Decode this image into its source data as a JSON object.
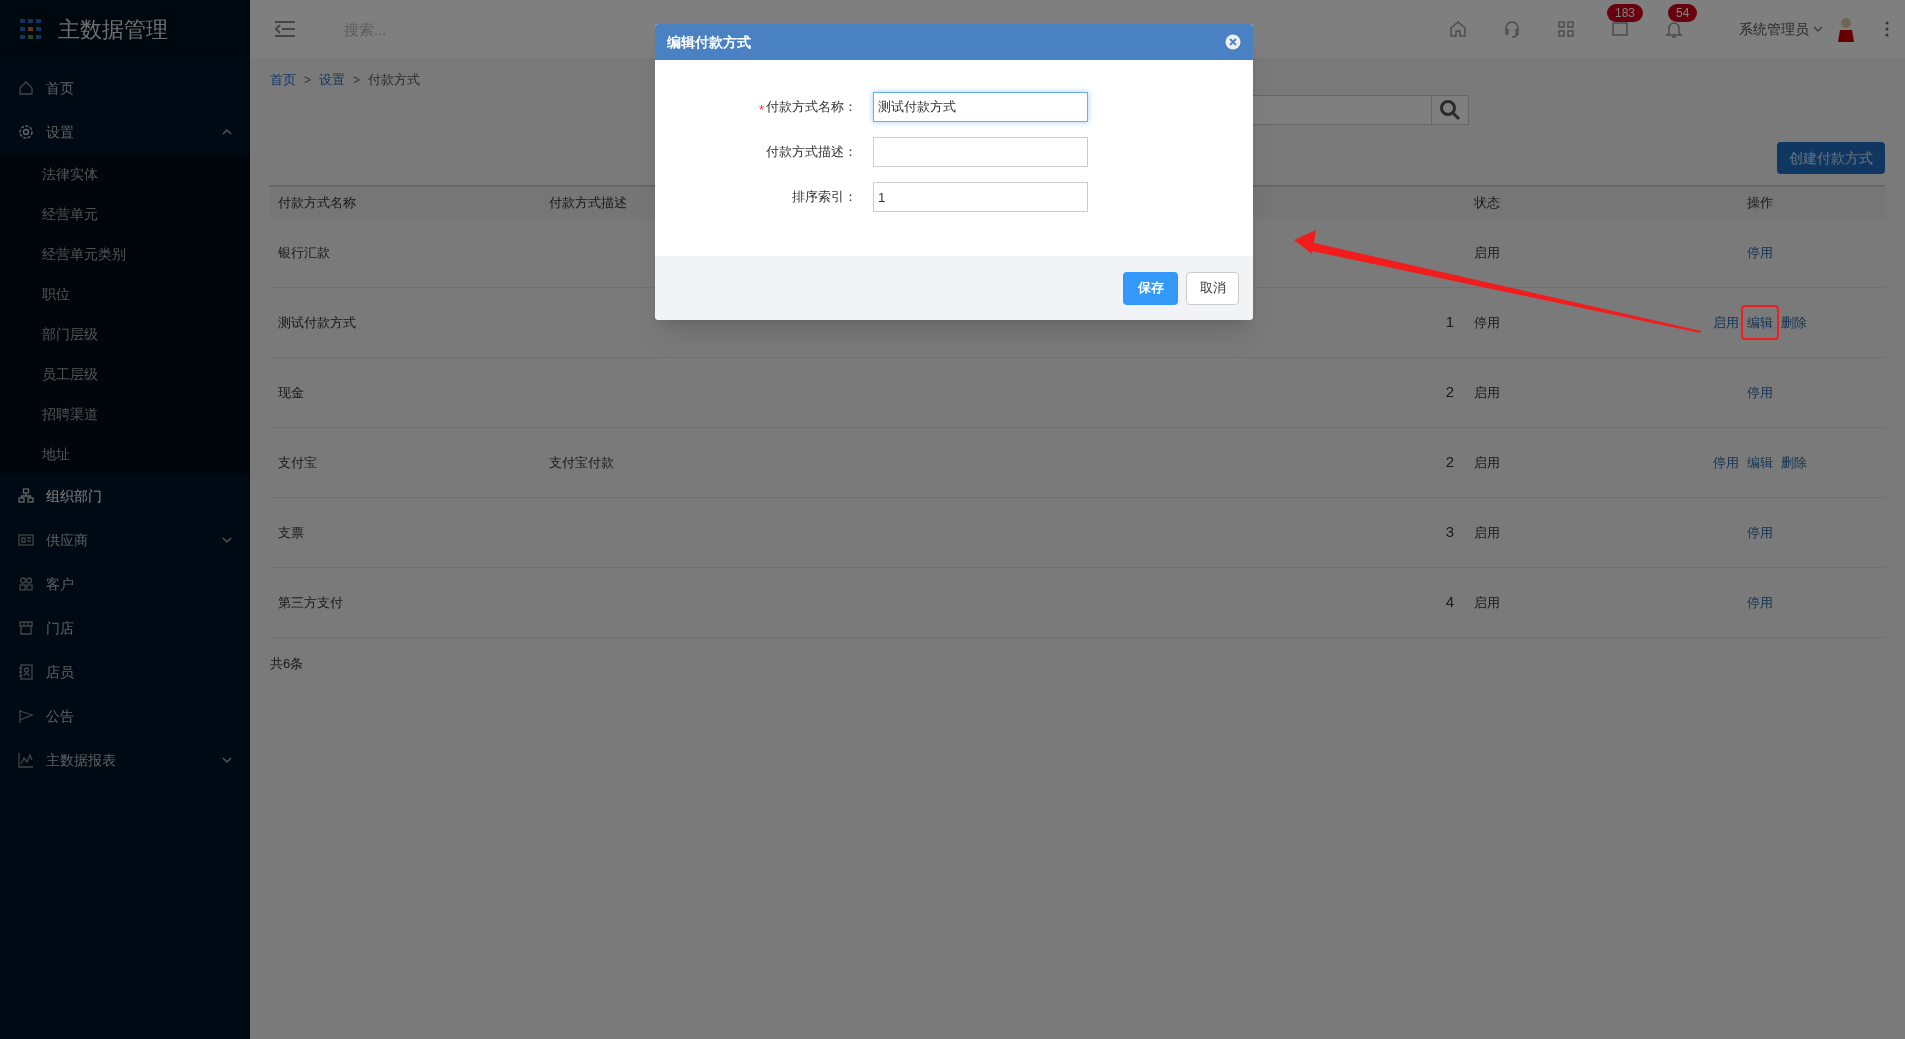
{
  "app": {
    "title": "主数据管理"
  },
  "sidebar": {
    "items": [
      {
        "label": "首页",
        "selected": false
      },
      {
        "label": "设置",
        "selected": false,
        "expanded": true,
        "children": [
          {
            "label": "法律实体",
            "selected": false
          },
          {
            "label": "经营单元",
            "selected": false
          },
          {
            "label": "经营单元类别",
            "selected": false
          },
          {
            "label": "职位",
            "selected": false
          },
          {
            "label": "部门层级",
            "selected": false
          },
          {
            "label": "员工层级",
            "selected": false
          },
          {
            "label": "招聘渠道",
            "selected": false
          },
          {
            "label": "地址",
            "selected": false
          }
        ]
      },
      {
        "label": "组织部门",
        "selected": true
      },
      {
        "label": "供应商",
        "selected": false,
        "expanded": false
      },
      {
        "label": "客户",
        "selected": false
      },
      {
        "label": "门店",
        "selected": false
      },
      {
        "label": "店员",
        "selected": false
      },
      {
        "label": "公告",
        "selected": false
      },
      {
        "label": "主数据报表",
        "selected": false,
        "expanded": false
      }
    ]
  },
  "header": {
    "search_placeholder": "搜索...",
    "message_badge": "183",
    "notification_badge": "54",
    "user": "系统管理员"
  },
  "breadcrumb": {
    "separator": ">",
    "items": [
      {
        "label": "首页",
        "link": true
      },
      {
        "label": "设置",
        "link": true
      },
      {
        "label": "付款方式",
        "link": false
      }
    ]
  },
  "toolbar": {
    "create_button": "创建付款方式"
  },
  "table": {
    "columns": [
      "付款方式名称",
      "付款方式描述",
      "状态",
      "操作"
    ],
    "rows": [
      {
        "name": "银行汇款",
        "status": "启用",
        "actions": [
          {
            "label": "停用",
            "highlighted": false
          }
        ]
      },
      {
        "name": "测试付款方式",
        "sort": "1",
        "status": "停用",
        "actions": [
          {
            "label": "启用",
            "highlighted": false
          },
          {
            "label": "编辑",
            "highlighted": true
          },
          {
            "label": "删除",
            "highlighted": false
          }
        ]
      },
      {
        "name": "现金",
        "sort": "2",
        "status": "启用",
        "actions": [
          {
            "label": "停用",
            "highlighted": false
          }
        ]
      },
      {
        "name": "支付宝",
        "description": "支付宝付款",
        "sort": "2",
        "status": "启用",
        "actions": [
          {
            "label": "停用",
            "highlighted": false
          },
          {
            "label": "编辑",
            "highlighted": false
          },
          {
            "label": "删除",
            "highlighted": false
          }
        ]
      },
      {
        "name": "支票",
        "sort": "3",
        "status": "启用",
        "actions": [
          {
            "label": "停用",
            "highlighted": false
          }
        ]
      },
      {
        "name": "第三方支付",
        "sort": "4",
        "status": "启用",
        "actions": [
          {
            "label": "停用",
            "highlighted": false
          }
        ]
      }
    ],
    "total": "共6条"
  },
  "modal": {
    "title": "编辑付款方式",
    "fields": [
      {
        "label": "付款方式名称：",
        "required": true,
        "value": "测试付款方式",
        "focused": true
      },
      {
        "label": "付款方式描述：",
        "required": false,
        "focused": false
      },
      {
        "label": "排序索引：",
        "required": false,
        "value": "1",
        "focused": false
      }
    ],
    "required_mark": "*",
    "save_button": "保存",
    "cancel_button": "取消"
  }
}
